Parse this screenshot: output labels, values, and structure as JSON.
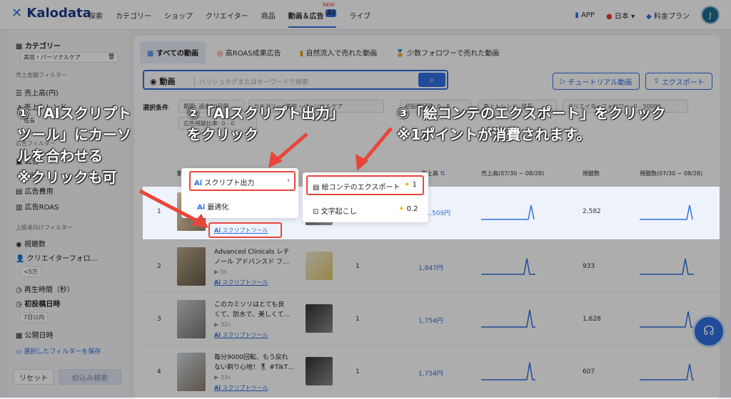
{
  "header": {
    "logo": "Kalodata",
    "nav": [
      "探索",
      "カテゴリー",
      "ショップ",
      "クリエイター",
      "商品",
      "動画＆広告",
      "ライブ"
    ],
    "ai_badge": "AI",
    "new_badge": "NEW",
    "app": "APP",
    "lang": "日本",
    "plan": "料金プラン",
    "avatar": "J"
  },
  "sidebar": {
    "category_label": "カテゴリー",
    "category_value": "美容・パーソナルケア",
    "sales_filter_head": "売上金額フィルター",
    "sales": "売上高(円)",
    "trend": "売上トレンド",
    "trend_value": "成長",
    "ad_filter_head": "広告フィルター",
    "ad": "広告",
    "ad_value": "広告なし",
    "ad_cost": "広告費用",
    "ad_roas": "広告ROAS",
    "adv_head": "上級者向けフィルター",
    "views": "視聴数",
    "creator_followers": "クリエイターフォロ…",
    "creator_followers_value": "<5万",
    "play_time": "再生時間（秒）",
    "first_post": "初投稿日時",
    "first_post_value": "7日以内",
    "public_time": "公開日時",
    "save_filter": "選択したフィルターを保存",
    "reset": "リセット",
    "search": "絞込み検索"
  },
  "tabs": [
    "すべての動画",
    "高ROAS成果広告",
    "自然流入で売れた動画",
    "少数フォロワーで売れた動画"
  ],
  "search": {
    "label": "動画",
    "placeholder": "ハッシュタグまたはキーワードで検索"
  },
  "buttons": {
    "tutorial": "チュートリアル動画",
    "export": "エクスポート"
  },
  "filters": {
    "label": "選択条件",
    "chips": [
      "期間: 過去30日間",
      "カテゴリー: 美容・パーソナルケア",
      "初投稿日時: 0 - 8",
      "売上トレンド: 成長",
      "クリエイターフォロワー: 0 - 50000",
      "広告視聴比率: 0 - 0"
    ]
  },
  "table": {
    "headers": [
      "動画",
      "売上高",
      "売上高(07/30 ~ 08/28)",
      "視聴数",
      "視聴数(07/30 ~ 08/28)"
    ],
    "rows": [
      {
        "rank": "1",
        "title": "",
        "duration": "",
        "script": "スクリプトツール",
        "count": "",
        "sales": "…509円",
        "views": "2,582"
      },
      {
        "rank": "2",
        "title": "Advanced Clinicals レチ",
        "title2": "ノール アドバンスド フ…",
        "duration": "5s",
        "script": "スクリプトツール",
        "count": "1",
        "sales": "1,847円",
        "views": "933"
      },
      {
        "rank": "3",
        "title": "このカミソリはとても良",
        "title2": "くて、防水で、美しくて…",
        "duration": "32s",
        "script": "スクリプトツール",
        "count": "1",
        "sales": "1,754円",
        "views": "1,628"
      },
      {
        "rank": "4",
        "title": "毎分9000回転、もう戻れ",
        "title2": "ない剃り心地！🎖 #TikT…",
        "duration": "33s",
        "script": "スクリプトツール",
        "count": "1",
        "sales": "1,754円",
        "views": "607"
      }
    ]
  },
  "menu1": {
    "script_output": "スクリプト出力",
    "optimize": "最適化"
  },
  "menu2": {
    "storyboard": "絵コンテのエクスポート",
    "storyboard_cost": "1",
    "transcript": "文字起こし",
    "transcript_cost": "0.2"
  },
  "annotations": {
    "a1_l1": "①「AIスクリプト",
    "a1_l2": "ツール」にカーソ",
    "a1_l3": "ルを合わせる",
    "a1_l4": "※クリックも可",
    "a2_l1": "②「AIスクリプト出力」",
    "a2_l2": "をクリック",
    "a3_l1": "③「絵コンテのエクスポート」をクリック",
    "a3_l2": "※1ポイントが消費されます。"
  },
  "colors": {
    "accent": "#2f6fe0",
    "annotation_red": "#e8463b"
  }
}
